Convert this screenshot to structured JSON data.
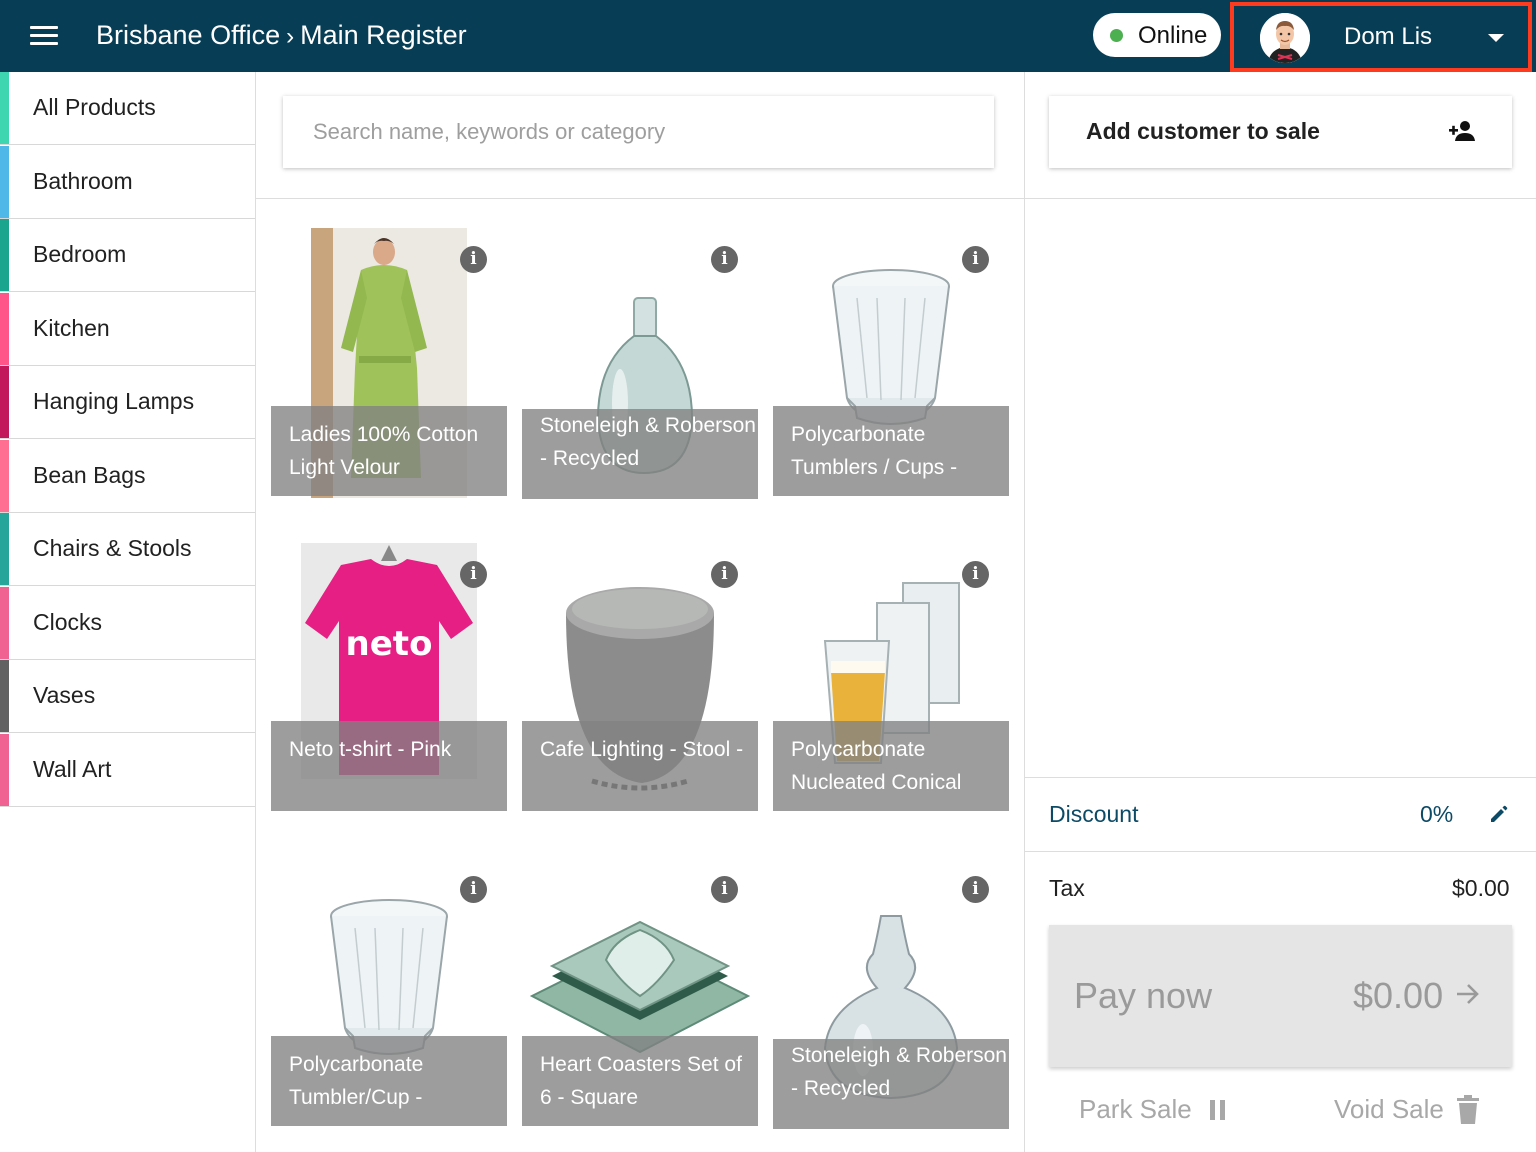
{
  "header": {
    "location": "Brisbane Office",
    "separator": "›",
    "register": "Main Register",
    "status": "Online",
    "user_name": "Dom Lis",
    "colors": {
      "bar": "#073e56",
      "online": "#4caf50",
      "highlight": "#ff3b1f"
    }
  },
  "sidebar": {
    "items": [
      {
        "label": "All Products",
        "color": "#3dd6b0"
      },
      {
        "label": "Bathroom",
        "color": "#4fb8e8"
      },
      {
        "label": "Bedroom",
        "color": "#1aa58e"
      },
      {
        "label": "Kitchen",
        "color": "#ff5588"
      },
      {
        "label": "Hanging Lamps",
        "color": "#c2185b"
      },
      {
        "label": "Bean Bags",
        "color": "#ff6f91"
      },
      {
        "label": "Chairs & Stools",
        "color": "#26a69a"
      },
      {
        "label": "Clocks",
        "color": "#f06292"
      },
      {
        "label": "Vases",
        "color": "#616161"
      },
      {
        "label": "Wall Art",
        "color": "#f06292"
      }
    ]
  },
  "search": {
    "placeholder": "Search name, keywords or category"
  },
  "products": [
    {
      "name": "Ladies 100% Cotton Light Velour",
      "image": "green-robe",
      "info_icon": "info-icon"
    },
    {
      "name": "Stoneleigh & Roberson - Recycled",
      "image": "glass-bottle",
      "info_icon": "info-icon"
    },
    {
      "name": "Polycarbonate Tumblers / Cups -",
      "image": "tumbler",
      "info_icon": "info-icon"
    },
    {
      "name": "Neto t-shirt - Pink",
      "image": "pink-tshirt",
      "shirt_text": "neto",
      "info_icon": "info-icon"
    },
    {
      "name": "Cafe Lighting - Stool -",
      "image": "grey-stool",
      "info_icon": "info-icon"
    },
    {
      "name": "Polycarbonate Nucleated Conical",
      "image": "beer-glasses",
      "info_icon": "info-icon"
    },
    {
      "name": "Polycarbonate Tumbler/Cup -",
      "image": "tumbler",
      "info_icon": "info-icon"
    },
    {
      "name": "Heart Coasters Set of 6 - Square",
      "image": "glass-coasters",
      "info_icon": "info-icon"
    },
    {
      "name": "Stoneleigh & Roberson - Recycled",
      "image": "glass-vase",
      "info_icon": "info-icon"
    }
  ],
  "cart": {
    "add_customer_label": "Add customer to sale",
    "discount_label": "Discount",
    "discount_value": "0%",
    "tax_label": "Tax",
    "tax_value": "$0.00",
    "pay_label": "Pay now",
    "pay_amount": "$0.00",
    "park_label": "Park Sale",
    "void_label": "Void Sale"
  }
}
